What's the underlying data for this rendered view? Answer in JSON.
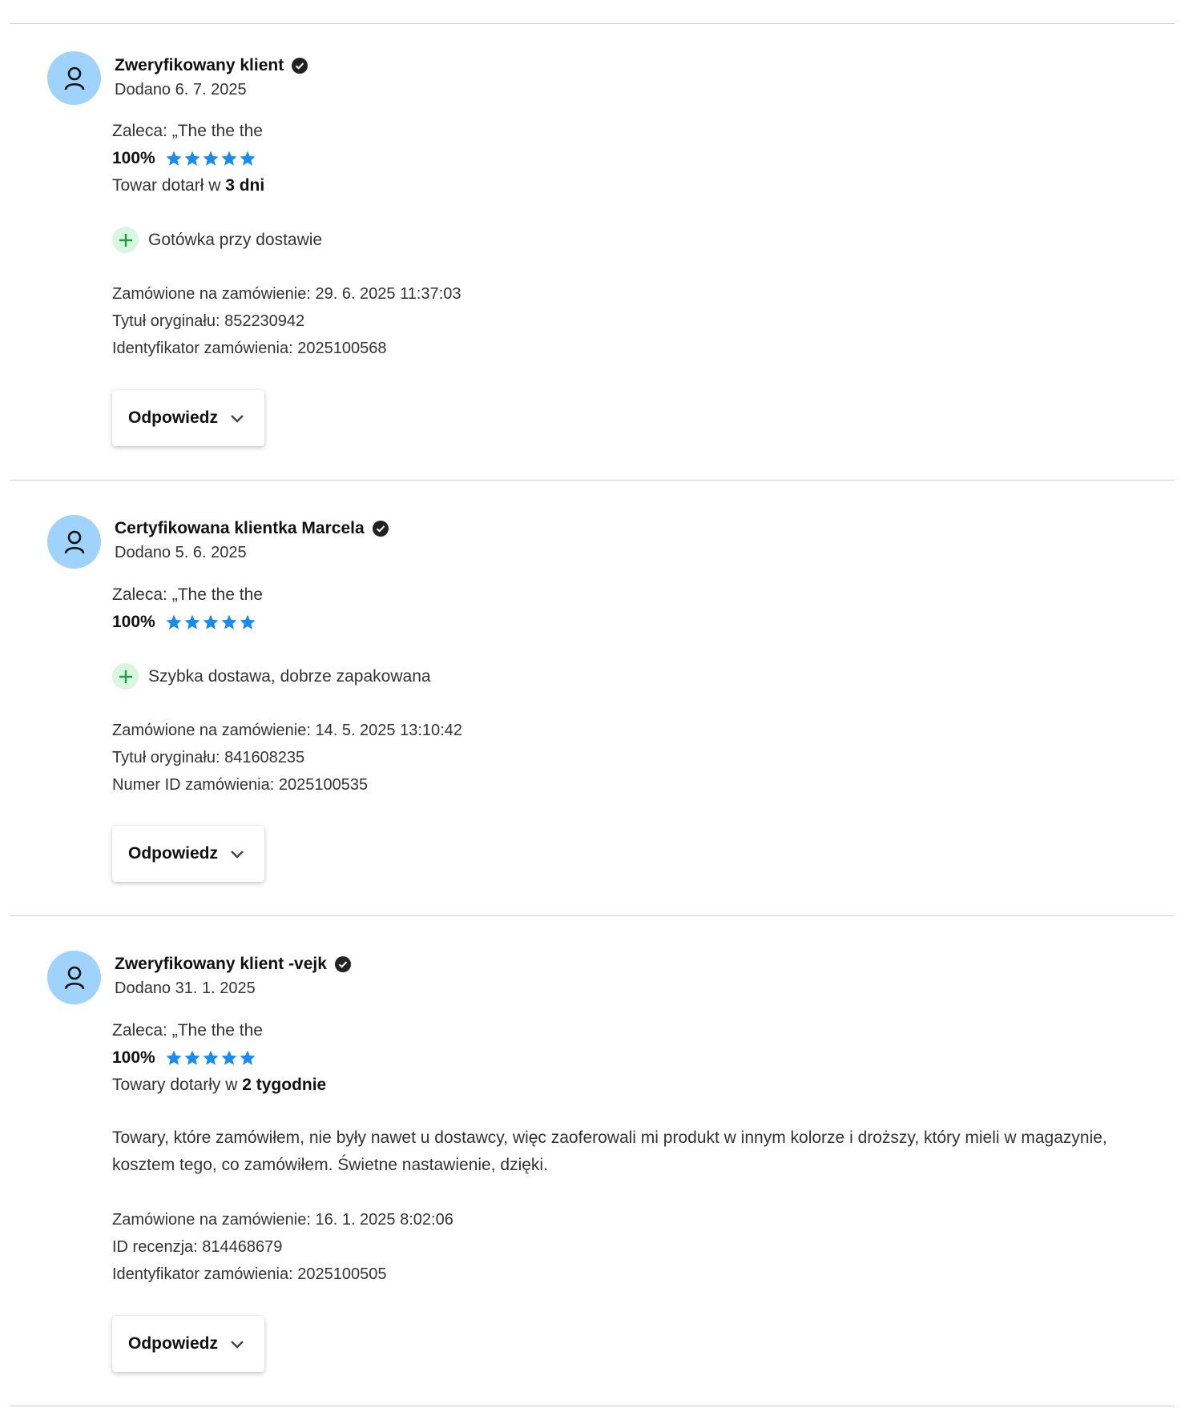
{
  "reviews": [
    {
      "author": "Zweryfikowany klient",
      "date": "Dodano 6. 7. 2025",
      "recommends": "Zaleca: „The the the",
      "rating_pct": "100%",
      "stars": 5,
      "delivery_prefix": "Towar dotarł w ",
      "delivery_value": "3 dni",
      "pro": "Gotówka przy dostawie",
      "meta": [
        "Zamówione na zamówienie: 29. 6. 2025 11:37:03",
        "Tytuł oryginału: 852230942",
        "Identyfikator zamówienia: 2025100568"
      ],
      "reply_label": "Odpowiedz"
    },
    {
      "author": "Certyfikowana klientka Marcela",
      "date": "Dodano 5. 6. 2025",
      "recommends": "Zaleca: „The the the",
      "rating_pct": "100%",
      "stars": 5,
      "pro": "Szybka dostawa, dobrze zapakowana",
      "meta": [
        "Zamówione na zamówienie: 14. 5. 2025 13:10:42",
        "Tytuł oryginału: 841608235",
        "Numer ID zamówienia: 2025100535"
      ],
      "reply_label": "Odpowiedz"
    },
    {
      "author": "Zweryfikowany klient -vejk",
      "date": "Dodano 31. 1. 2025",
      "recommends": "Zaleca: „The the the",
      "rating_pct": "100%",
      "stars": 5,
      "delivery_prefix": "Towary dotarły w ",
      "delivery_value": "2 tygodnie",
      "text": "Towary, które zamówiłem, nie były nawet u dostawcy, więc zaoferowali mi produkt w innym kolorze i droższy, który mieli w magazynie, kosztem tego, co zamówiłem. Świetne nastawienie, dzięki.",
      "meta": [
        "Zamówione na zamówienie: 16. 1. 2025 8:02:06",
        "ID recenzja: 814468679",
        "Identyfikator zamówienia: 2025100505"
      ],
      "reply_label": "Odpowiedz"
    }
  ],
  "colors": {
    "avatar_bg": "#9fd3fb",
    "star": "#1a8cf0",
    "plus_bg": "#d9f6df",
    "plus": "#1e9e3e"
  },
  "icons": [
    "user-icon",
    "verified-check-icon",
    "star-icon",
    "plus-icon",
    "chevron-down-icon"
  ]
}
